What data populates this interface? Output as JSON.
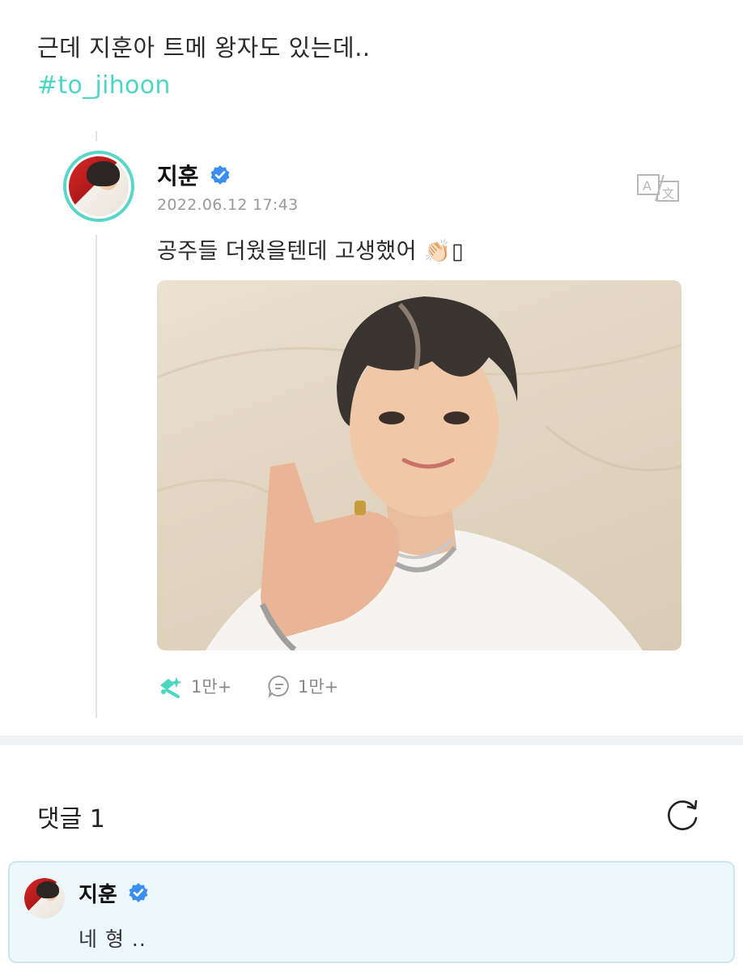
{
  "post": {
    "text": "근데 지훈아 트메 왕자도 있는데..",
    "hashtag": "#to_jihoon"
  },
  "card": {
    "author": "지훈",
    "date": "2022.06.12 17:43",
    "body": "공주들 더웠을텐데 고생했어 👏🏻▯",
    "likes": "1만+",
    "comments_count": "1만+"
  },
  "comments": {
    "title": "댓글 1",
    "items": [
      {
        "author": "지훈",
        "text": "네 형 .."
      }
    ]
  },
  "colors": {
    "accent": "#4fd6c3",
    "verified": "#3b8ff0",
    "comment_bg": "#edf8fc"
  },
  "icons": [
    "verified-badge-icon",
    "translate-icon",
    "light-stick-icon",
    "comment-bubble-icon",
    "refresh-icon"
  ]
}
